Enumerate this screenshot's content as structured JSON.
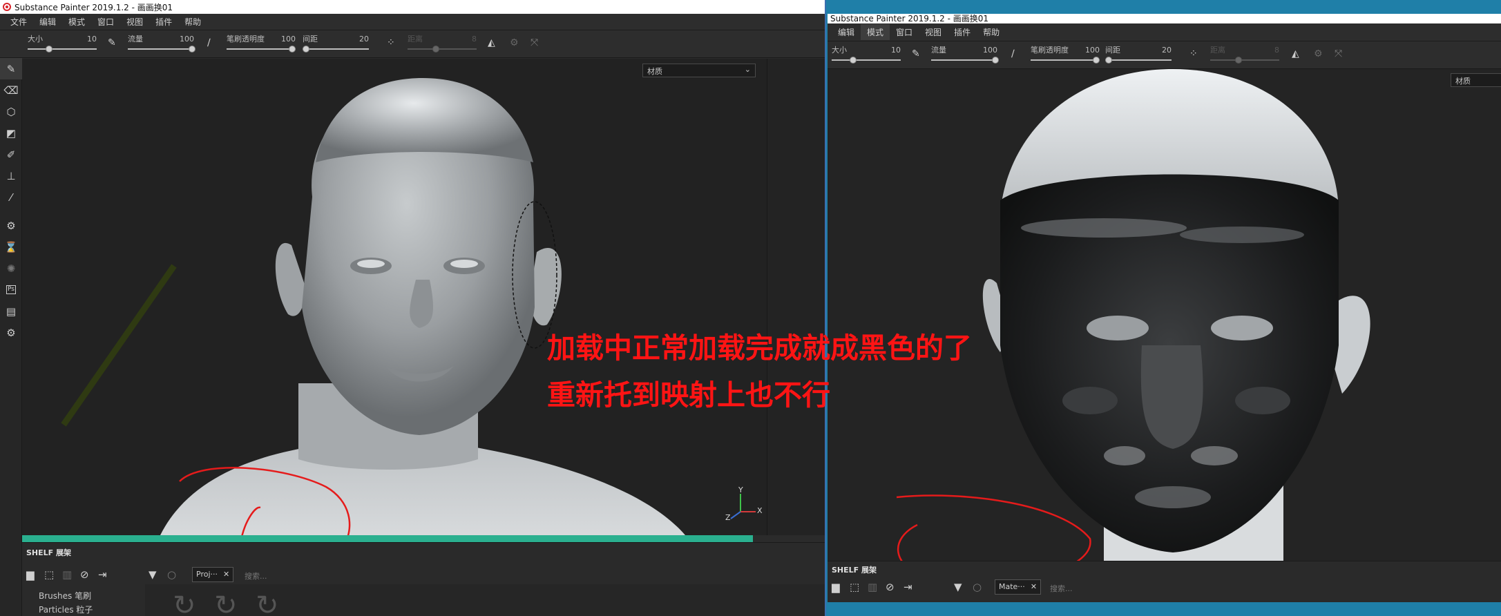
{
  "left_window": {
    "title": "Substance Painter 2019.1.2 - 画画换01",
    "menus": [
      "文件",
      "编辑",
      "模式",
      "窗口",
      "视图",
      "插件",
      "帮助"
    ],
    "tool_props": {
      "size": {
        "label": "大小",
        "value": "10"
      },
      "flow": {
        "label": "流量",
        "value": "100"
      },
      "opacity": {
        "label": "笔刷透明度",
        "value": "100"
      },
      "spacing": {
        "label": "间距",
        "value": "20"
      },
      "distance": {
        "label": "距离",
        "value": "8"
      }
    },
    "viewport_dropdown": "材质",
    "axis_labels": {
      "y": "Y",
      "x": "X",
      "z": "Z"
    },
    "shelf": {
      "title": "SHELF 展架",
      "tab": "Proj···",
      "search_placeholder": "搜索...",
      "items": [
        "Brushes 笔刷",
        "Particles 粒子"
      ]
    }
  },
  "right_window": {
    "title": "Substance Painter 2019.1.2 - 画画换01",
    "menus": [
      "编辑",
      "模式",
      "窗口",
      "视图",
      "插件",
      "帮助"
    ],
    "active_menu": "模式",
    "tool_props": {
      "size": {
        "label": "大小",
        "value": "10"
      },
      "flow": {
        "label": "流量",
        "value": "100"
      },
      "opacity": {
        "label": "笔刷透明度",
        "value": "100"
      },
      "spacing": {
        "label": "间距",
        "value": "20"
      },
      "distance": {
        "label": "距离",
        "value": "8"
      }
    },
    "viewport_dropdown": "材质",
    "shelf": {
      "title": "SHELF 展架",
      "tab": "Mate···",
      "search_placeholder": "搜索..."
    }
  },
  "annotation": {
    "line1": "加载中正常加载完成就成黑色的了",
    "line2": "重新托到映射上也不行",
    "color": "#ff1414"
  },
  "colors": {
    "progress": "#2ab08f",
    "panel": "#2b2b2b",
    "desktop": "#1f7fa8"
  },
  "icons": [
    "brush-icon",
    "eraser-icon",
    "projection-icon",
    "polygon-fill-icon",
    "smudge-icon",
    "clone-stamp-icon",
    "color-picker-icon",
    "filter-icon",
    "folder-icon"
  ]
}
